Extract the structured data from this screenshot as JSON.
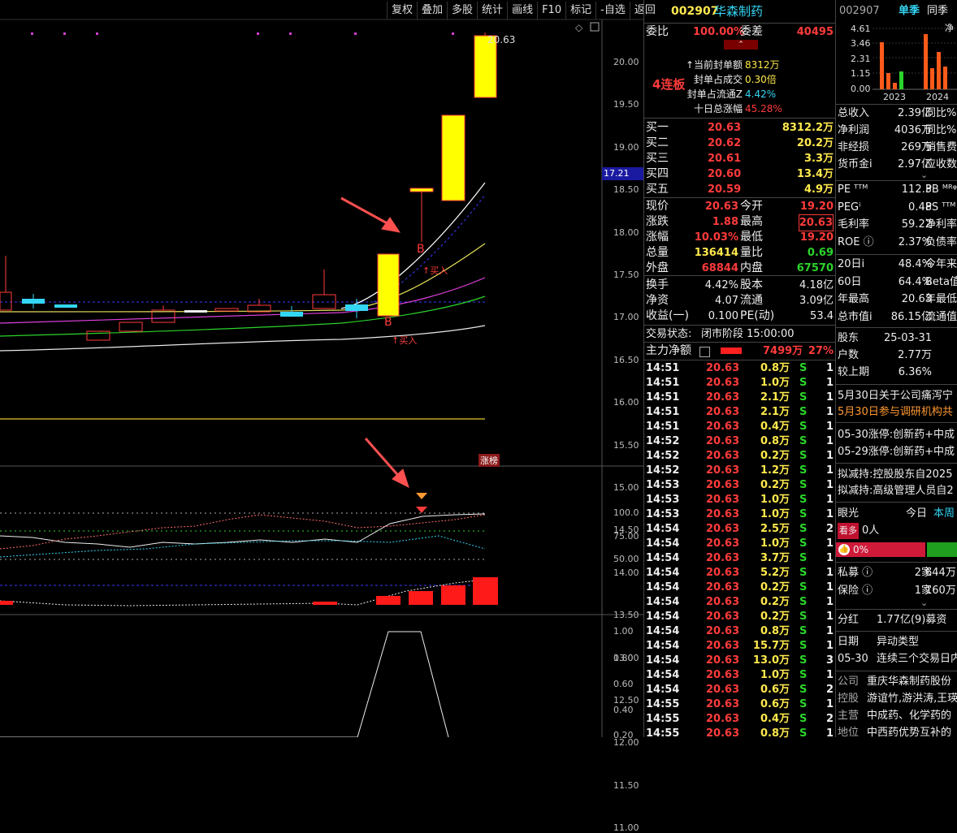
{
  "toolbar": [
    "复权",
    "叠加",
    "多股",
    "统计",
    "画线",
    "F10",
    "标记",
    "-自选",
    "返回"
  ],
  "price_axis": [
    "20.00",
    "19.50",
    "19.00",
    "18.50",
    "18.00",
    "17.50",
    "17.00",
    "16.50",
    "16.00",
    "15.50",
    "15.00",
    "14.50",
    "14.00",
    "13.50",
    "13.00",
    "12.50",
    "12.00",
    "11.50",
    "11.00"
  ],
  "price_tag": "17.21",
  "high_label": "20.63",
  "chart_marks": {
    "b1": "B",
    "b2": "B",
    "buy1": "↑买入",
    "buy2": "↑买入",
    "zhangbang": "涨榜"
  },
  "indicator_axis": [
    "100.0",
    "75.00",
    "50.00"
  ],
  "lower_axis": [
    "1.00",
    "0.80",
    "0.60",
    "0.40",
    "0.20"
  ],
  "quote": {
    "code": "002907",
    "name": "华森制药",
    "weibi_label": "委比",
    "weibi_value": "100.00%",
    "weicha_label": "委差",
    "weicha_value": "40495",
    "lianban": "4连板",
    "seal_rows": [
      {
        "label": "当前封单额",
        "value": "8312万",
        "prefix": "↑"
      },
      {
        "label": "封单占成交",
        "value": "0.30倍",
        "prefix": ""
      },
      {
        "label": "封单占流通Z",
        "value": "4.42%",
        "prefix": ""
      },
      {
        "label": "十日总涨幅",
        "value": "45.28%",
        "prefix": ""
      }
    ],
    "bids": [
      {
        "label": "买一",
        "price": "20.63",
        "vol": "8312.2万"
      },
      {
        "label": "买二",
        "price": "20.62",
        "vol": "20.2万"
      },
      {
        "label": "买三",
        "price": "20.61",
        "vol": "3.3万"
      },
      {
        "label": "买四",
        "price": "20.60",
        "vol": "13.4万"
      },
      {
        "label": "买五",
        "price": "20.59",
        "vol": "4.9万"
      }
    ],
    "stats": [
      {
        "l1": "现价",
        "v1": "20.63",
        "l2": "今开",
        "v2": "19.20"
      },
      {
        "l1": "涨跌",
        "v1": "1.88",
        "l2": "最高",
        "v2": "20.63"
      },
      {
        "l1": "涨幅",
        "v1": "10.03%",
        "l2": "最低",
        "v2": "19.20"
      },
      {
        "l1": "总量",
        "v1": "136414",
        "l2": "量比",
        "v2": "0.69"
      },
      {
        "l1": "外盘",
        "v1": "68844",
        "l2": "内盘",
        "v2": "67570"
      }
    ],
    "stats2": [
      {
        "l1": "换手",
        "v1": "4.42%",
        "l2": "股本",
        "v2": "4.18亿"
      },
      {
        "l1": "净资",
        "v1": "4.07",
        "l2": "流通",
        "v2": "3.09亿"
      },
      {
        "l1": "收益(一)",
        "v1": "0.100",
        "l2": "PE(动)",
        "v2": "53.4"
      }
    ],
    "trade_status_label": "交易状态:",
    "trade_status_value": "闭市阶段 15:00:00",
    "main_net_label": "主力净额",
    "main_net_value": "7499万",
    "main_net_pct": "27%",
    "ticks": [
      {
        "t": "14:51",
        "p": "20.63",
        "v": "0.8万",
        "s": "S",
        "n": "1"
      },
      {
        "t": "14:51",
        "p": "20.63",
        "v": "1.0万",
        "s": "S",
        "n": "1"
      },
      {
        "t": "14:51",
        "p": "20.63",
        "v": "2.1万",
        "s": "S",
        "n": "1"
      },
      {
        "t": "14:51",
        "p": "20.63",
        "v": "2.1万",
        "s": "S",
        "n": "1"
      },
      {
        "t": "14:51",
        "p": "20.63",
        "v": "0.4万",
        "s": "S",
        "n": "1"
      },
      {
        "t": "14:52",
        "p": "20.63",
        "v": "0.8万",
        "s": "S",
        "n": "1"
      },
      {
        "t": "14:52",
        "p": "20.63",
        "v": "0.2万",
        "s": "S",
        "n": "1"
      },
      {
        "t": "14:52",
        "p": "20.63",
        "v": "1.2万",
        "s": "S",
        "n": "1"
      },
      {
        "t": "14:53",
        "p": "20.63",
        "v": "0.2万",
        "s": "S",
        "n": "1"
      },
      {
        "t": "14:53",
        "p": "20.63",
        "v": "1.0万",
        "s": "S",
        "n": "1"
      },
      {
        "t": "14:53",
        "p": "20.63",
        "v": "1.0万",
        "s": "S",
        "n": "1"
      },
      {
        "t": "14:54",
        "p": "20.63",
        "v": "2.5万",
        "s": "S",
        "n": "2"
      },
      {
        "t": "14:54",
        "p": "20.63",
        "v": "1.0万",
        "s": "S",
        "n": "1"
      },
      {
        "t": "14:54",
        "p": "20.63",
        "v": "3.7万",
        "s": "S",
        "n": "1"
      },
      {
        "t": "14:54",
        "p": "20.63",
        "v": "5.2万",
        "s": "S",
        "n": "1"
      },
      {
        "t": "14:54",
        "p": "20.63",
        "v": "0.2万",
        "s": "S",
        "n": "1"
      },
      {
        "t": "14:54",
        "p": "20.63",
        "v": "0.2万",
        "s": "S",
        "n": "1"
      },
      {
        "t": "14:54",
        "p": "20.63",
        "v": "0.2万",
        "s": "S",
        "n": "1"
      },
      {
        "t": "14:54",
        "p": "20.63",
        "v": "0.8万",
        "s": "S",
        "n": "1"
      },
      {
        "t": "14:54",
        "p": "20.63",
        "v": "15.7万",
        "s": "S",
        "n": "1"
      },
      {
        "t": "14:54",
        "p": "20.63",
        "v": "13.0万",
        "s": "S",
        "n": "3"
      },
      {
        "t": "14:54",
        "p": "20.63",
        "v": "1.0万",
        "s": "S",
        "n": "1"
      },
      {
        "t": "14:54",
        "p": "20.63",
        "v": "0.6万",
        "s": "S",
        "n": "2"
      },
      {
        "t": "14:55",
        "p": "20.63",
        "v": "0.6万",
        "s": "S",
        "n": "1"
      },
      {
        "t": "14:55",
        "p": "20.63",
        "v": "0.4万",
        "s": "S",
        "n": "2"
      },
      {
        "t": "14:55",
        "p": "20.63",
        "v": "0.8万",
        "s": "S",
        "n": "1"
      }
    ]
  },
  "info": {
    "code": "002907",
    "tab1": "单季",
    "tab2": "同季",
    "tab3": "净",
    "mini_axis": [
      "4.61",
      "3.46",
      "2.31",
      "1.15",
      "0.00"
    ],
    "mini_years": [
      "2023",
      "2024"
    ],
    "rows1": [
      {
        "l": "总收入",
        "v": "2.39亿",
        "r": "同比%"
      },
      {
        "l": "净利润",
        "v": "4036万",
        "r": "同比%"
      },
      {
        "l": "非经损",
        "v": "269万",
        "r": "销售费"
      },
      {
        "l": "货币金i",
        "v": "2.97亿",
        "r": "应收数"
      }
    ],
    "rows2": [
      {
        "l": "PE ᵀᵀᴹ",
        "v": "112.3",
        "r": "PB ᴹᴿᵠ"
      },
      {
        "l": "PEGⁱ",
        "v": "0.48",
        "r": "PS ᵀᵀᴹ"
      },
      {
        "l": "毛利率",
        "v": "59.22",
        "r": "净利率"
      },
      {
        "l": "ROE ⓘ",
        "v": "2.37%",
        "r": "负债率"
      }
    ],
    "rows3": [
      {
        "l": "20日i",
        "v": "48.4%",
        "r": "今年来"
      },
      {
        "l": "60日",
        "v": "64.4%",
        "r": "Beta值"
      },
      {
        "l": "年最高",
        "v": "20.63",
        "r": "年最低"
      },
      {
        "l": "总市值i",
        "v": "86.15亿",
        "r": "流通值"
      }
    ],
    "rows4": [
      {
        "l": "股东",
        "v": "25-03-31"
      },
      {
        "l": "户数",
        "v": "2.77万"
      },
      {
        "l": "较上期",
        "v": "6.36%"
      }
    ],
    "news1": "5月30日关于公司痛泻宁",
    "news2": "5月30日参与调研机构共",
    "limit1": "05-30涨停:创新药+中成",
    "limit2": "05-29涨停:创新药+中成",
    "reduce1": "拟减持:控股股东自2025",
    "reduce2": "拟减持:高级管理人员自2",
    "eye_label": "眼光",
    "eye_today": "今日",
    "eye_week": "本周",
    "bull_label": "看多",
    "bull_count": "0人",
    "bull_pct": "0%",
    "fund_rows": [
      {
        "l": "私募 ⓘ",
        "v": "2家",
        "r": "644万"
      },
      {
        "l": "保险 ⓘ",
        "v": "1家",
        "r": "160万"
      }
    ],
    "dividend_label": "分红",
    "dividend_value": "1.77亿(9)募资",
    "date_label": "日期",
    "type_label": "异动类型",
    "event_date": "05-30",
    "event_type": "连续三个交易日内",
    "company_label": "公司",
    "company_value": "重庆华森制药股份",
    "holder_label": "控股",
    "holder_value": "游谊竹,游洪涛,王瑛",
    "main_label": "主营",
    "main_value": "中成药、化学药的",
    "position_label": "地位",
    "position_value": "中西药优势互补的"
  }
}
